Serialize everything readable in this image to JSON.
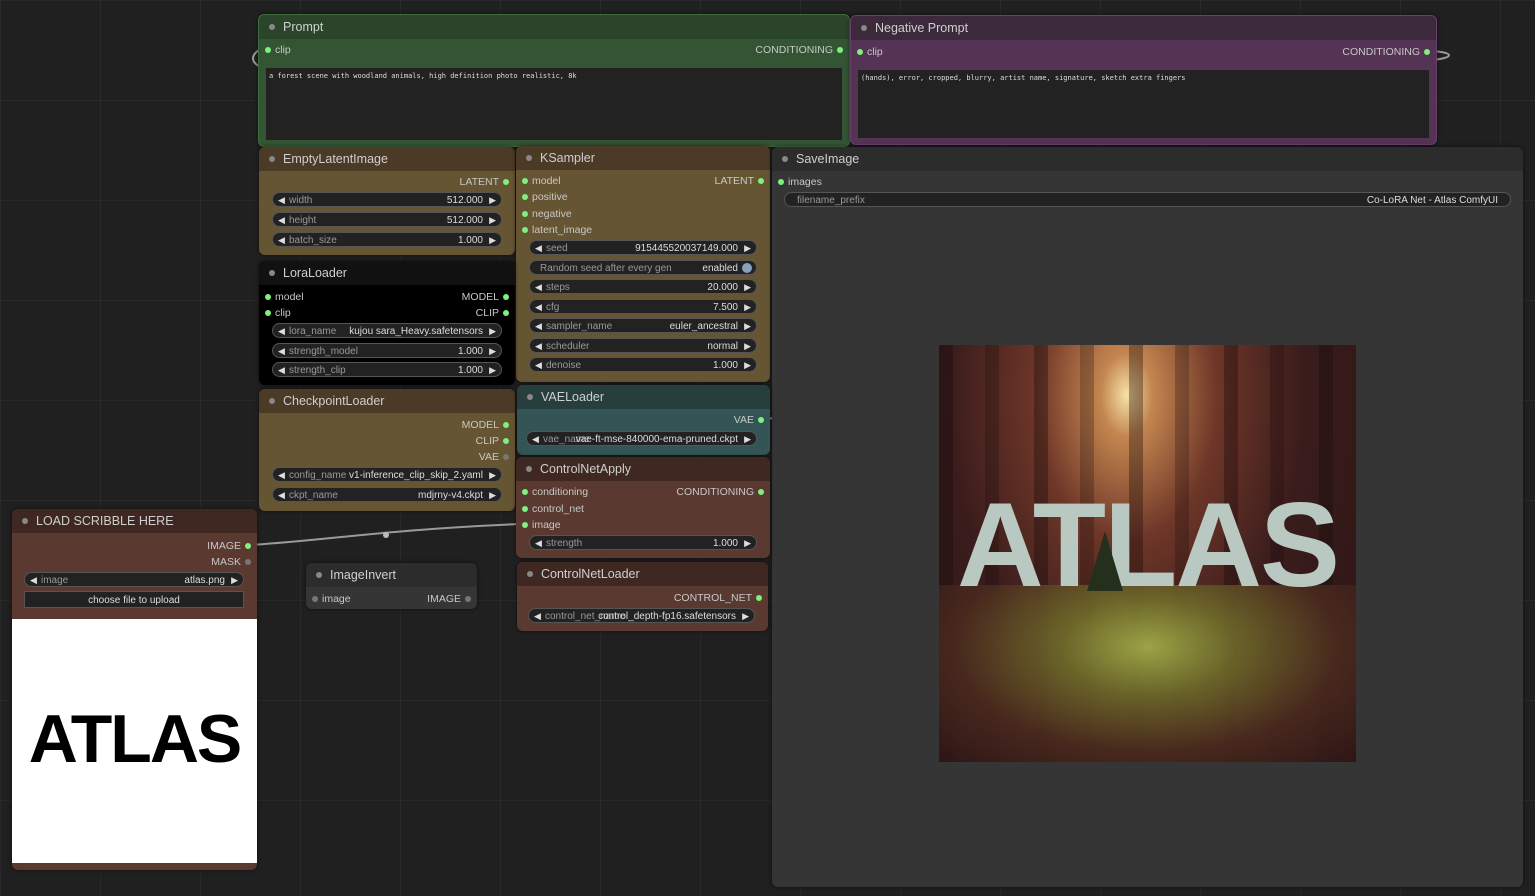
{
  "prompt": {
    "title": "Prompt",
    "input_clip": "clip",
    "output": "CONDITIONING",
    "text": "a forest scene with woodland animals, high definition photo realistic, 8k"
  },
  "negative": {
    "title": "Negative Prompt",
    "input_clip": "clip",
    "output": "CONDITIONING",
    "text": "(hands), error, cropped, blurry, artist name, signature, sketch extra fingers"
  },
  "empty_latent": {
    "title": "EmptyLatentImage",
    "output": "LATENT",
    "widgets": [
      {
        "label": "width",
        "value": "512.000"
      },
      {
        "label": "height",
        "value": "512.000"
      },
      {
        "label": "batch_size",
        "value": "1.000"
      }
    ]
  },
  "ksampler": {
    "title": "KSampler",
    "inputs": [
      "model",
      "positive",
      "negative",
      "latent_image"
    ],
    "output": "LATENT",
    "seed_label": "seed",
    "seed_value": "915445520037149.000",
    "toggle_label": "Random seed after every gen",
    "toggle_value": "enabled",
    "widgets": [
      {
        "label": "steps",
        "value": "20.000"
      },
      {
        "label": "cfg",
        "value": "7.500"
      },
      {
        "label": "sampler_name",
        "value": "euler_ancestral"
      },
      {
        "label": "scheduler",
        "value": "normal"
      },
      {
        "label": "denoise",
        "value": "1.000"
      }
    ]
  },
  "save_image": {
    "title": "SaveImage",
    "input": "images",
    "prefix_label": "filename_prefix",
    "prefix_value": "Co-LoRA Net - Atlas ComfyUI",
    "preview_text": "ATLAS"
  },
  "lora": {
    "title": "LoraLoader",
    "inputs": [
      "model",
      "clip"
    ],
    "outputs": [
      "MODEL",
      "CLIP"
    ],
    "widgets": [
      {
        "label": "lora_name",
        "value": "kujou sara_Heavy.safetensors"
      },
      {
        "label": "strength_model",
        "value": "1.000"
      },
      {
        "label": "strength_clip",
        "value": "1.000"
      }
    ]
  },
  "checkpoint": {
    "title": "CheckpointLoader",
    "outputs": [
      "MODEL",
      "CLIP",
      "VAE"
    ],
    "widgets": [
      {
        "label": "config_name",
        "value": "v1-inference_clip_skip_2.yaml"
      },
      {
        "label": "ckpt_name",
        "value": "mdjrny-v4.ckpt"
      }
    ]
  },
  "vae": {
    "title": "VAELoader",
    "output": "VAE",
    "widget_label": "vae_name",
    "widget_value": "vae-ft-mse-840000-ema-pruned.ckpt"
  },
  "controlnet_apply": {
    "title": "ControlNetApply",
    "inputs": [
      "conditioning",
      "control_net",
      "image"
    ],
    "output": "CONDITIONING",
    "widget_label": "strength",
    "widget_value": "1.000"
  },
  "controlnet_loader": {
    "title": "ControlNetLoader",
    "output": "CONTROL_NET",
    "widget_label": "control_net_name",
    "widget_value": "control_depth-fp16.safetensors"
  },
  "load_image": {
    "title": "LOAD SCRIBBLE HERE",
    "outputs": [
      "IMAGE",
      "MASK"
    ],
    "widget_label": "image",
    "widget_value": "atlas.png",
    "upload_label": "choose file to upload",
    "preview_text": "ATLAS"
  },
  "invert": {
    "title": "ImageInvert",
    "input": "image",
    "output": "IMAGE"
  },
  "colors": {
    "pin_green": "#7ff07f",
    "prompt_green": "#335533",
    "negative_purple": "#553355",
    "brown": "#593930",
    "olive": "#665533",
    "teal": "#335555"
  }
}
